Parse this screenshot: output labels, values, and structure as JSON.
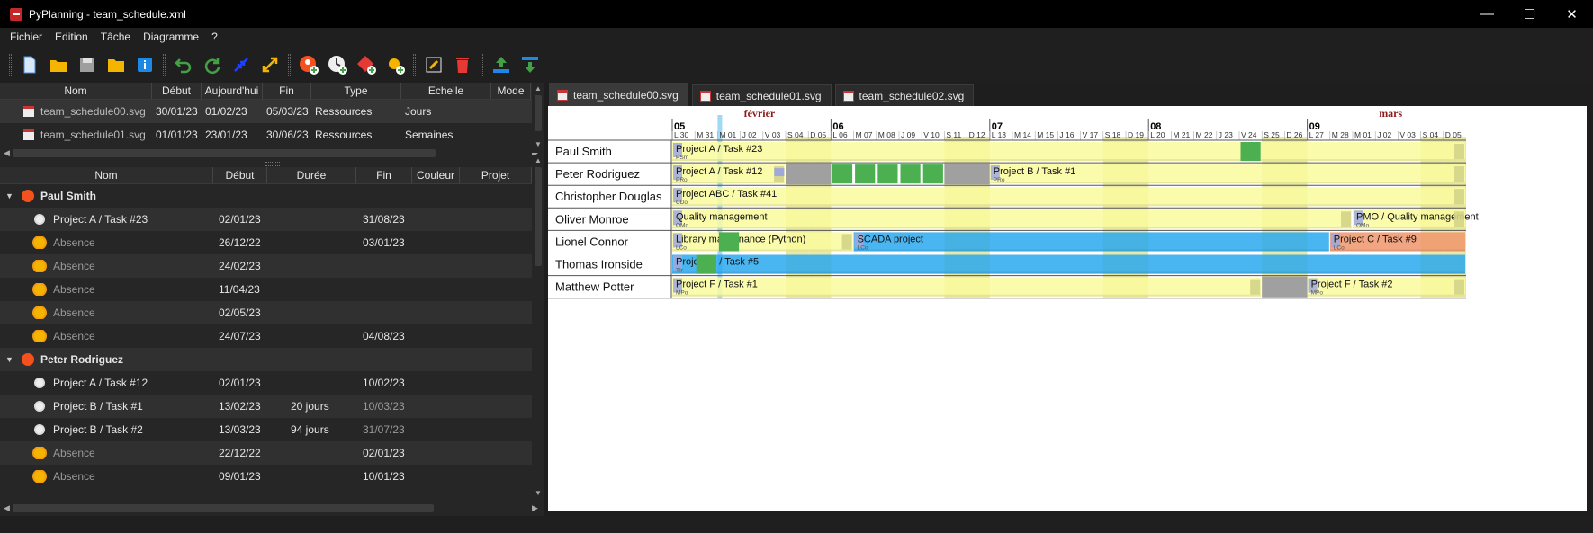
{
  "window": {
    "title": "PyPlanning - team_schedule.xml",
    "min": "—",
    "max": "☐",
    "close": "✕"
  },
  "menu": [
    "Fichier",
    "Edition",
    "Tâche",
    "Diagramme",
    "?"
  ],
  "toolbar": [
    "new-file-icon",
    "open-folder-icon",
    "save-icon",
    "folder-icon",
    "info-icon",
    "undo-icon",
    "redo-icon",
    "collapse-icon",
    "expand-icon",
    "add-resource-icon",
    "add-task-icon",
    "add-milestone-icon",
    "add-absence-icon",
    "edit-icon",
    "delete-icon",
    "move-up-icon",
    "move-down-icon"
  ],
  "chartsTable": {
    "headers": [
      "Nom",
      "Début",
      "Aujourd'hui",
      "Fin",
      "Type",
      "Echelle",
      "Mode"
    ],
    "rows": [
      {
        "name": "team_schedule00.svg",
        "start": "30/01/23",
        "today": "01/02/23",
        "end": "05/03/23",
        "type": "Ressources",
        "scale": "Jours"
      },
      {
        "name": "team_schedule01.svg",
        "start": "01/01/23",
        "today": "23/01/23",
        "end": "30/06/23",
        "type": "Ressources",
        "scale": "Semaines"
      }
    ]
  },
  "tasksTable": {
    "headers": [
      "Nom",
      "Début",
      "Durée",
      "Fin",
      "Couleur",
      "Projet"
    ],
    "rows": [
      {
        "kind": "resource",
        "name": "Paul Smith",
        "start": "",
        "duration": "",
        "end": ""
      },
      {
        "kind": "task",
        "name": "Project A / Task #23",
        "start": "02/01/23",
        "duration": "",
        "end": "31/08/23"
      },
      {
        "kind": "absence",
        "name": "Absence",
        "start": "26/12/22",
        "duration": "",
        "end": "03/01/23"
      },
      {
        "kind": "absence",
        "name": "Absence",
        "start": "24/02/23",
        "duration": "",
        "end": ""
      },
      {
        "kind": "absence",
        "name": "Absence",
        "start": "11/04/23",
        "duration": "",
        "end": ""
      },
      {
        "kind": "absence",
        "name": "Absence",
        "start": "02/05/23",
        "duration": "",
        "end": ""
      },
      {
        "kind": "absence",
        "name": "Absence",
        "start": "24/07/23",
        "duration": "",
        "end": "04/08/23"
      },
      {
        "kind": "resource",
        "name": "Peter Rodriguez",
        "start": "",
        "duration": "",
        "end": ""
      },
      {
        "kind": "task",
        "name": "Project A / Task #12",
        "start": "02/01/23",
        "duration": "",
        "end": "10/02/23"
      },
      {
        "kind": "task",
        "name": "Project B / Task #1",
        "start": "13/02/23",
        "duration": "20 jours",
        "end": "10/03/23",
        "endGray": true
      },
      {
        "kind": "task",
        "name": "Project B / Task #2",
        "start": "13/03/23",
        "duration": "94 jours",
        "end": "31/07/23",
        "endGray": true
      },
      {
        "kind": "absence",
        "name": "Absence",
        "start": "22/12/22",
        "duration": "",
        "end": "02/01/23"
      },
      {
        "kind": "absence",
        "name": "Absence",
        "start": "09/01/23",
        "duration": "",
        "end": "10/01/23"
      }
    ]
  },
  "tabs": [
    "team_schedule00.svg",
    "team_schedule01.svg",
    "team_schedule02.svg"
  ],
  "gantt": {
    "months": [
      {
        "label": "février",
        "day": 3
      },
      {
        "label": "mars",
        "day": 31
      }
    ],
    "weeks": [
      {
        "label": "05",
        "day": 0
      },
      {
        "label": "06",
        "day": 7
      },
      {
        "label": "07",
        "day": 14
      },
      {
        "label": "08",
        "day": 21
      },
      {
        "label": "09",
        "day": 28
      }
    ],
    "dayLabels": [
      "L 30",
      "M 31",
      "M 01",
      "J 02",
      "V 03",
      "S 04",
      "D 05",
      "L 06",
      "M 07",
      "M 08",
      "J 09",
      "V 10",
      "S 11",
      "D 12",
      "L 13",
      "M 14",
      "M 15",
      "J 16",
      "V 17",
      "S 18",
      "D 19",
      "L 20",
      "M 21",
      "M 22",
      "J 23",
      "V 24",
      "S 25",
      "D 26",
      "L 27",
      "M 28",
      "M 01",
      "J 02",
      "V 03",
      "S 04",
      "D 05"
    ],
    "todayIndex": 2,
    "resources": [
      "Paul Smith",
      "Peter Rodriguez",
      "Christopher Douglas",
      "Oliver Monroe",
      "Lionel Connor",
      "Thomas Ironside",
      "Matthew Potter"
    ],
    "bars": [
      {
        "row": 0,
        "start": 0,
        "end": 35,
        "color": "#fafa9e",
        "label": "Project A / Task #23",
        "sub": "PSm"
      },
      {
        "row": 0,
        "start": 25,
        "end": 26,
        "color": "#4caf50",
        "label": "",
        "sub": ""
      },
      {
        "row": 1,
        "start": 0,
        "end": 5,
        "color": "#fafa9e",
        "label": "Project A / Task #12",
        "sub": "PRo"
      },
      {
        "row": 1,
        "start": 7,
        "end": 8,
        "color": "#4caf50",
        "label": "",
        "sub": ""
      },
      {
        "row": 1,
        "start": 8,
        "end": 9,
        "color": "#4caf50",
        "label": "",
        "sub": ""
      },
      {
        "row": 1,
        "start": 9,
        "end": 10,
        "color": "#4caf50",
        "label": "",
        "sub": ""
      },
      {
        "row": 1,
        "start": 10,
        "end": 11,
        "color": "#4caf50",
        "label": "",
        "sub": ""
      },
      {
        "row": 1,
        "start": 11,
        "end": 12,
        "color": "#4caf50",
        "label": "",
        "sub": ""
      },
      {
        "row": 1,
        "start": 14,
        "end": 35,
        "color": "#fafa9e",
        "label": "Project B / Task #1",
        "sub": "PRo"
      },
      {
        "row": 2,
        "start": 0,
        "end": 35,
        "color": "#fafa9e",
        "label": "Project ABC / Task #41",
        "sub": "CDo"
      },
      {
        "row": 3,
        "start": 0,
        "end": 30,
        "color": "#fafa9e",
        "label": "Quality management",
        "sub": "OMo"
      },
      {
        "row": 3,
        "start": 30,
        "end": 35,
        "color": "#fafa9e",
        "label": "PMO / Quality management",
        "sub": "OMo"
      },
      {
        "row": 4,
        "start": 0,
        "end": 8,
        "color": "#fafa9e",
        "label": "Library maintenance (Python)",
        "sub": "LCo"
      },
      {
        "row": 4,
        "start": 2,
        "end": 3,
        "color": "#4caf50",
        "label": "",
        "sub": ""
      },
      {
        "row": 4,
        "start": 8,
        "end": 29,
        "color": "#29a8ee",
        "label": "SCADA project",
        "sub": "LCo"
      },
      {
        "row": 4,
        "start": 29,
        "end": 35,
        "color": "#f0956b",
        "label": "Project C / Task #9",
        "sub": "LCo"
      },
      {
        "row": 5,
        "start": 0,
        "end": 35,
        "color": "#29a8ee",
        "label": "Project D / Task #5",
        "sub": "TIr"
      },
      {
        "row": 5,
        "start": 1,
        "end": 2,
        "color": "#4caf50",
        "label": "",
        "sub": ""
      },
      {
        "row": 6,
        "start": 0,
        "end": 26,
        "color": "#fafa9e",
        "label": "Project F / Task #1",
        "sub": "MPo"
      },
      {
        "row": 6,
        "start": 28,
        "end": 35,
        "color": "#fafa9e",
        "label": "Project F / Task #2",
        "sub": "MPo"
      }
    ],
    "absences": [
      {
        "row": 1,
        "start": 5,
        "end": 7
      },
      {
        "row": 1,
        "start": 12,
        "end": 14
      },
      {
        "row": 6,
        "start": 26,
        "end": 28
      }
    ],
    "colors": {
      "weekend": "#e8e8a8",
      "today": "#9fd9f5",
      "month": "#8b1c1c",
      "grid": "#bdbdbd",
      "absence": "#a0a0a0"
    }
  }
}
